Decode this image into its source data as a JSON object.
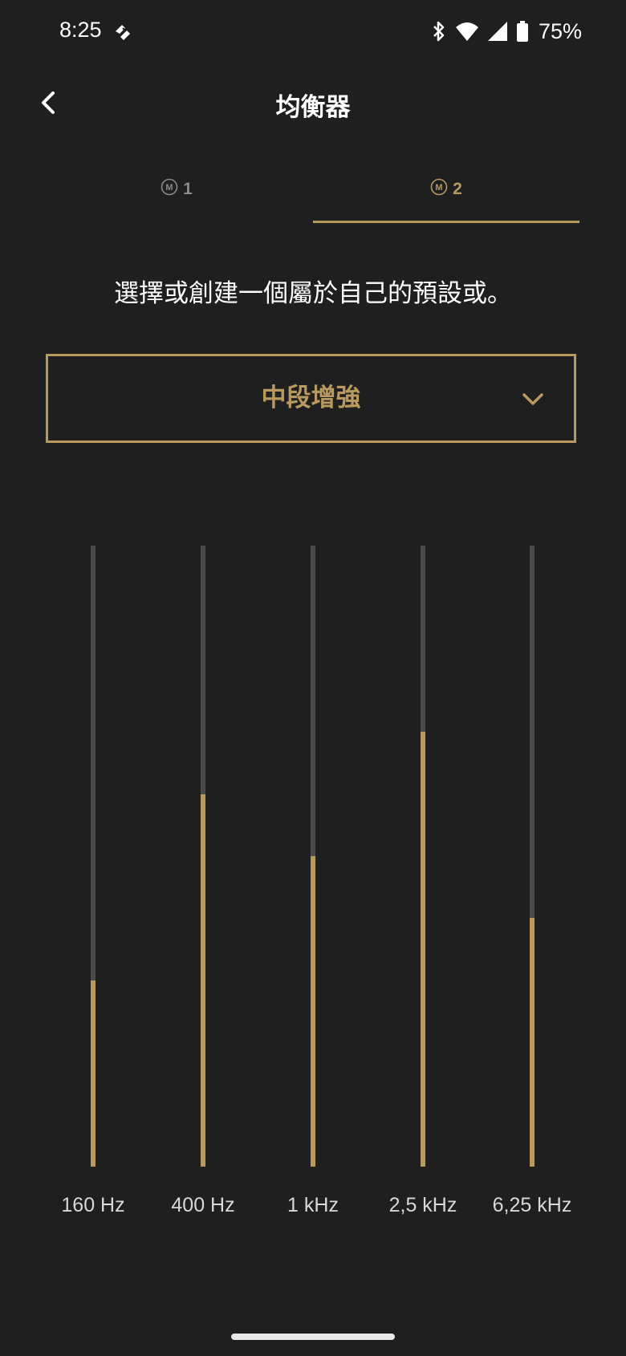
{
  "status_bar": {
    "time": "8:25",
    "battery_percent": "75%",
    "icons": [
      "app-notification-icon",
      "bluetooth-icon",
      "wifi-icon",
      "cell-signal-icon",
      "battery-icon"
    ]
  },
  "header": {
    "title": "均衡器",
    "back_icon": "chevron-left-icon"
  },
  "tabs": [
    {
      "label": "1",
      "badge": "M",
      "selected": false
    },
    {
      "label": "2",
      "badge": "M",
      "selected": true
    }
  ],
  "description": "選擇或創建一個屬於自己的預設或。",
  "preset": {
    "selected": "中段增強",
    "icon": "chevron-down-icon"
  },
  "equalizer": {
    "bands": [
      {
        "label": "160 Hz",
        "level_percent": 30
      },
      {
        "label": "400 Hz",
        "level_percent": 60
      },
      {
        "label": "1 kHz",
        "level_percent": 50
      },
      {
        "label": "2,5 kHz",
        "level_percent": 70
      },
      {
        "label": "6,25 kHz",
        "level_percent": 40
      }
    ]
  },
  "colors": {
    "background": "#1f1f1f",
    "accent": "#b89a5e",
    "track": "#4a4a4a",
    "tab_inactive": "#8a8a8a"
  }
}
